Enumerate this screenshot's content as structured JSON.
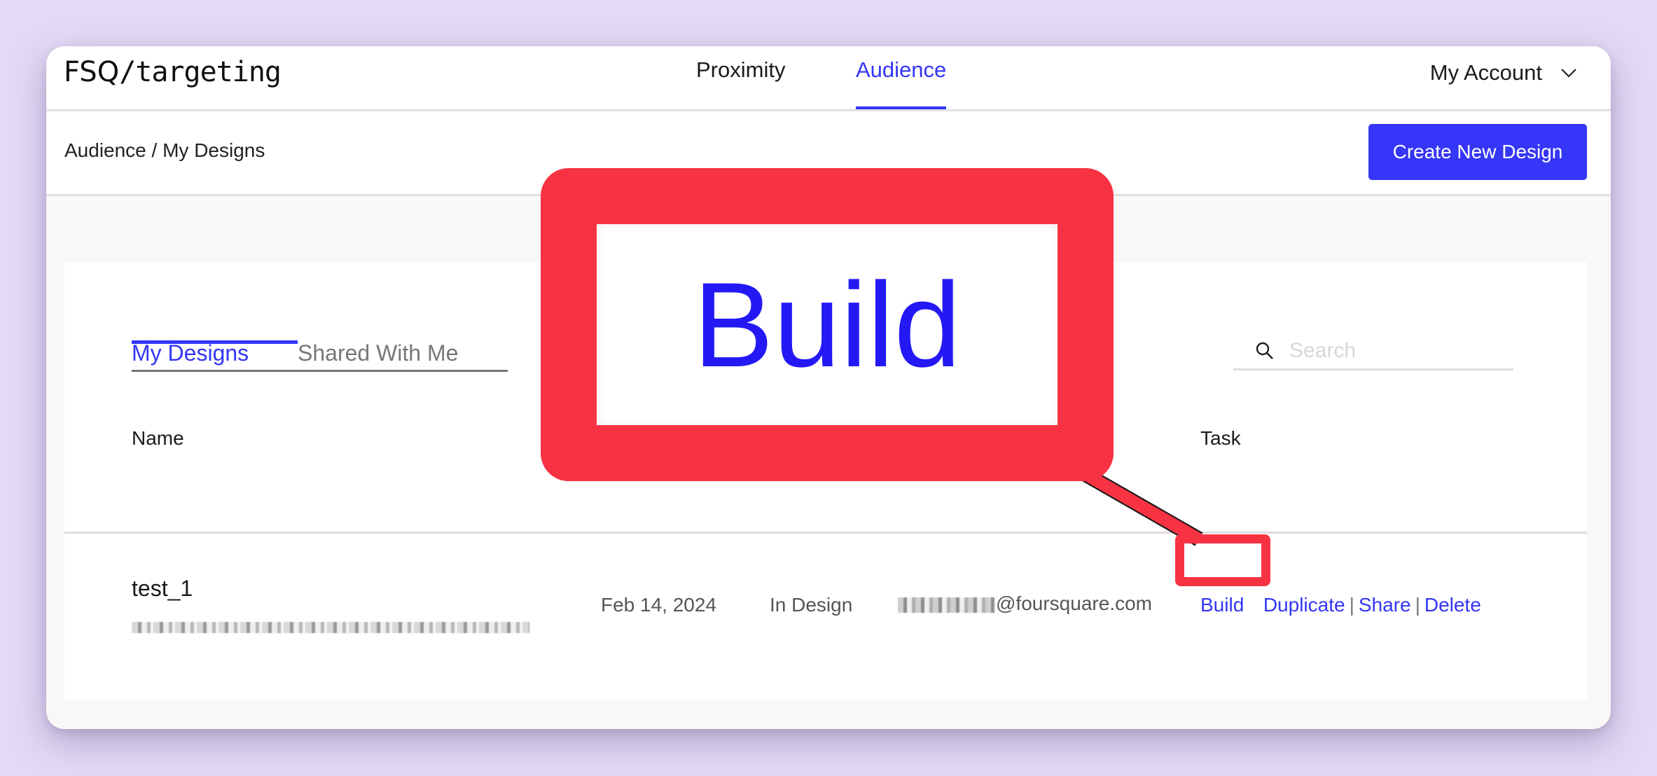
{
  "app": {
    "logo_brand": "FSQ",
    "logo_product": "/targeting"
  },
  "nav": {
    "items": [
      {
        "label": "Proximity",
        "active": false
      },
      {
        "label": "Audience",
        "active": true
      }
    ],
    "account_label": "My Account",
    "account_icon": "chevron-down-icon"
  },
  "subheader": {
    "breadcrumb": "Audience / My Designs",
    "create_button": "Create New Design"
  },
  "designs": {
    "tabs": [
      {
        "label": "My Designs",
        "active": true
      },
      {
        "label": "Shared With Me",
        "active": false
      }
    ],
    "search": {
      "placeholder": "Search",
      "value": "",
      "icon": "search-icon"
    },
    "columns": [
      "Name",
      "Task"
    ],
    "rows": [
      {
        "name": "test_1",
        "id": "[redacted]",
        "date": "Feb 14, 2024",
        "status": "In Design",
        "owner_domain": "@foursquare.com",
        "tasks": [
          "Build",
          "Duplicate",
          "Share",
          "Delete"
        ]
      }
    ]
  },
  "annotation": {
    "callout_text": "Build",
    "highlight_target": "Build",
    "color": "#f73343"
  },
  "colors": {
    "accent": "#3536f7",
    "background": "#e3daf7"
  }
}
